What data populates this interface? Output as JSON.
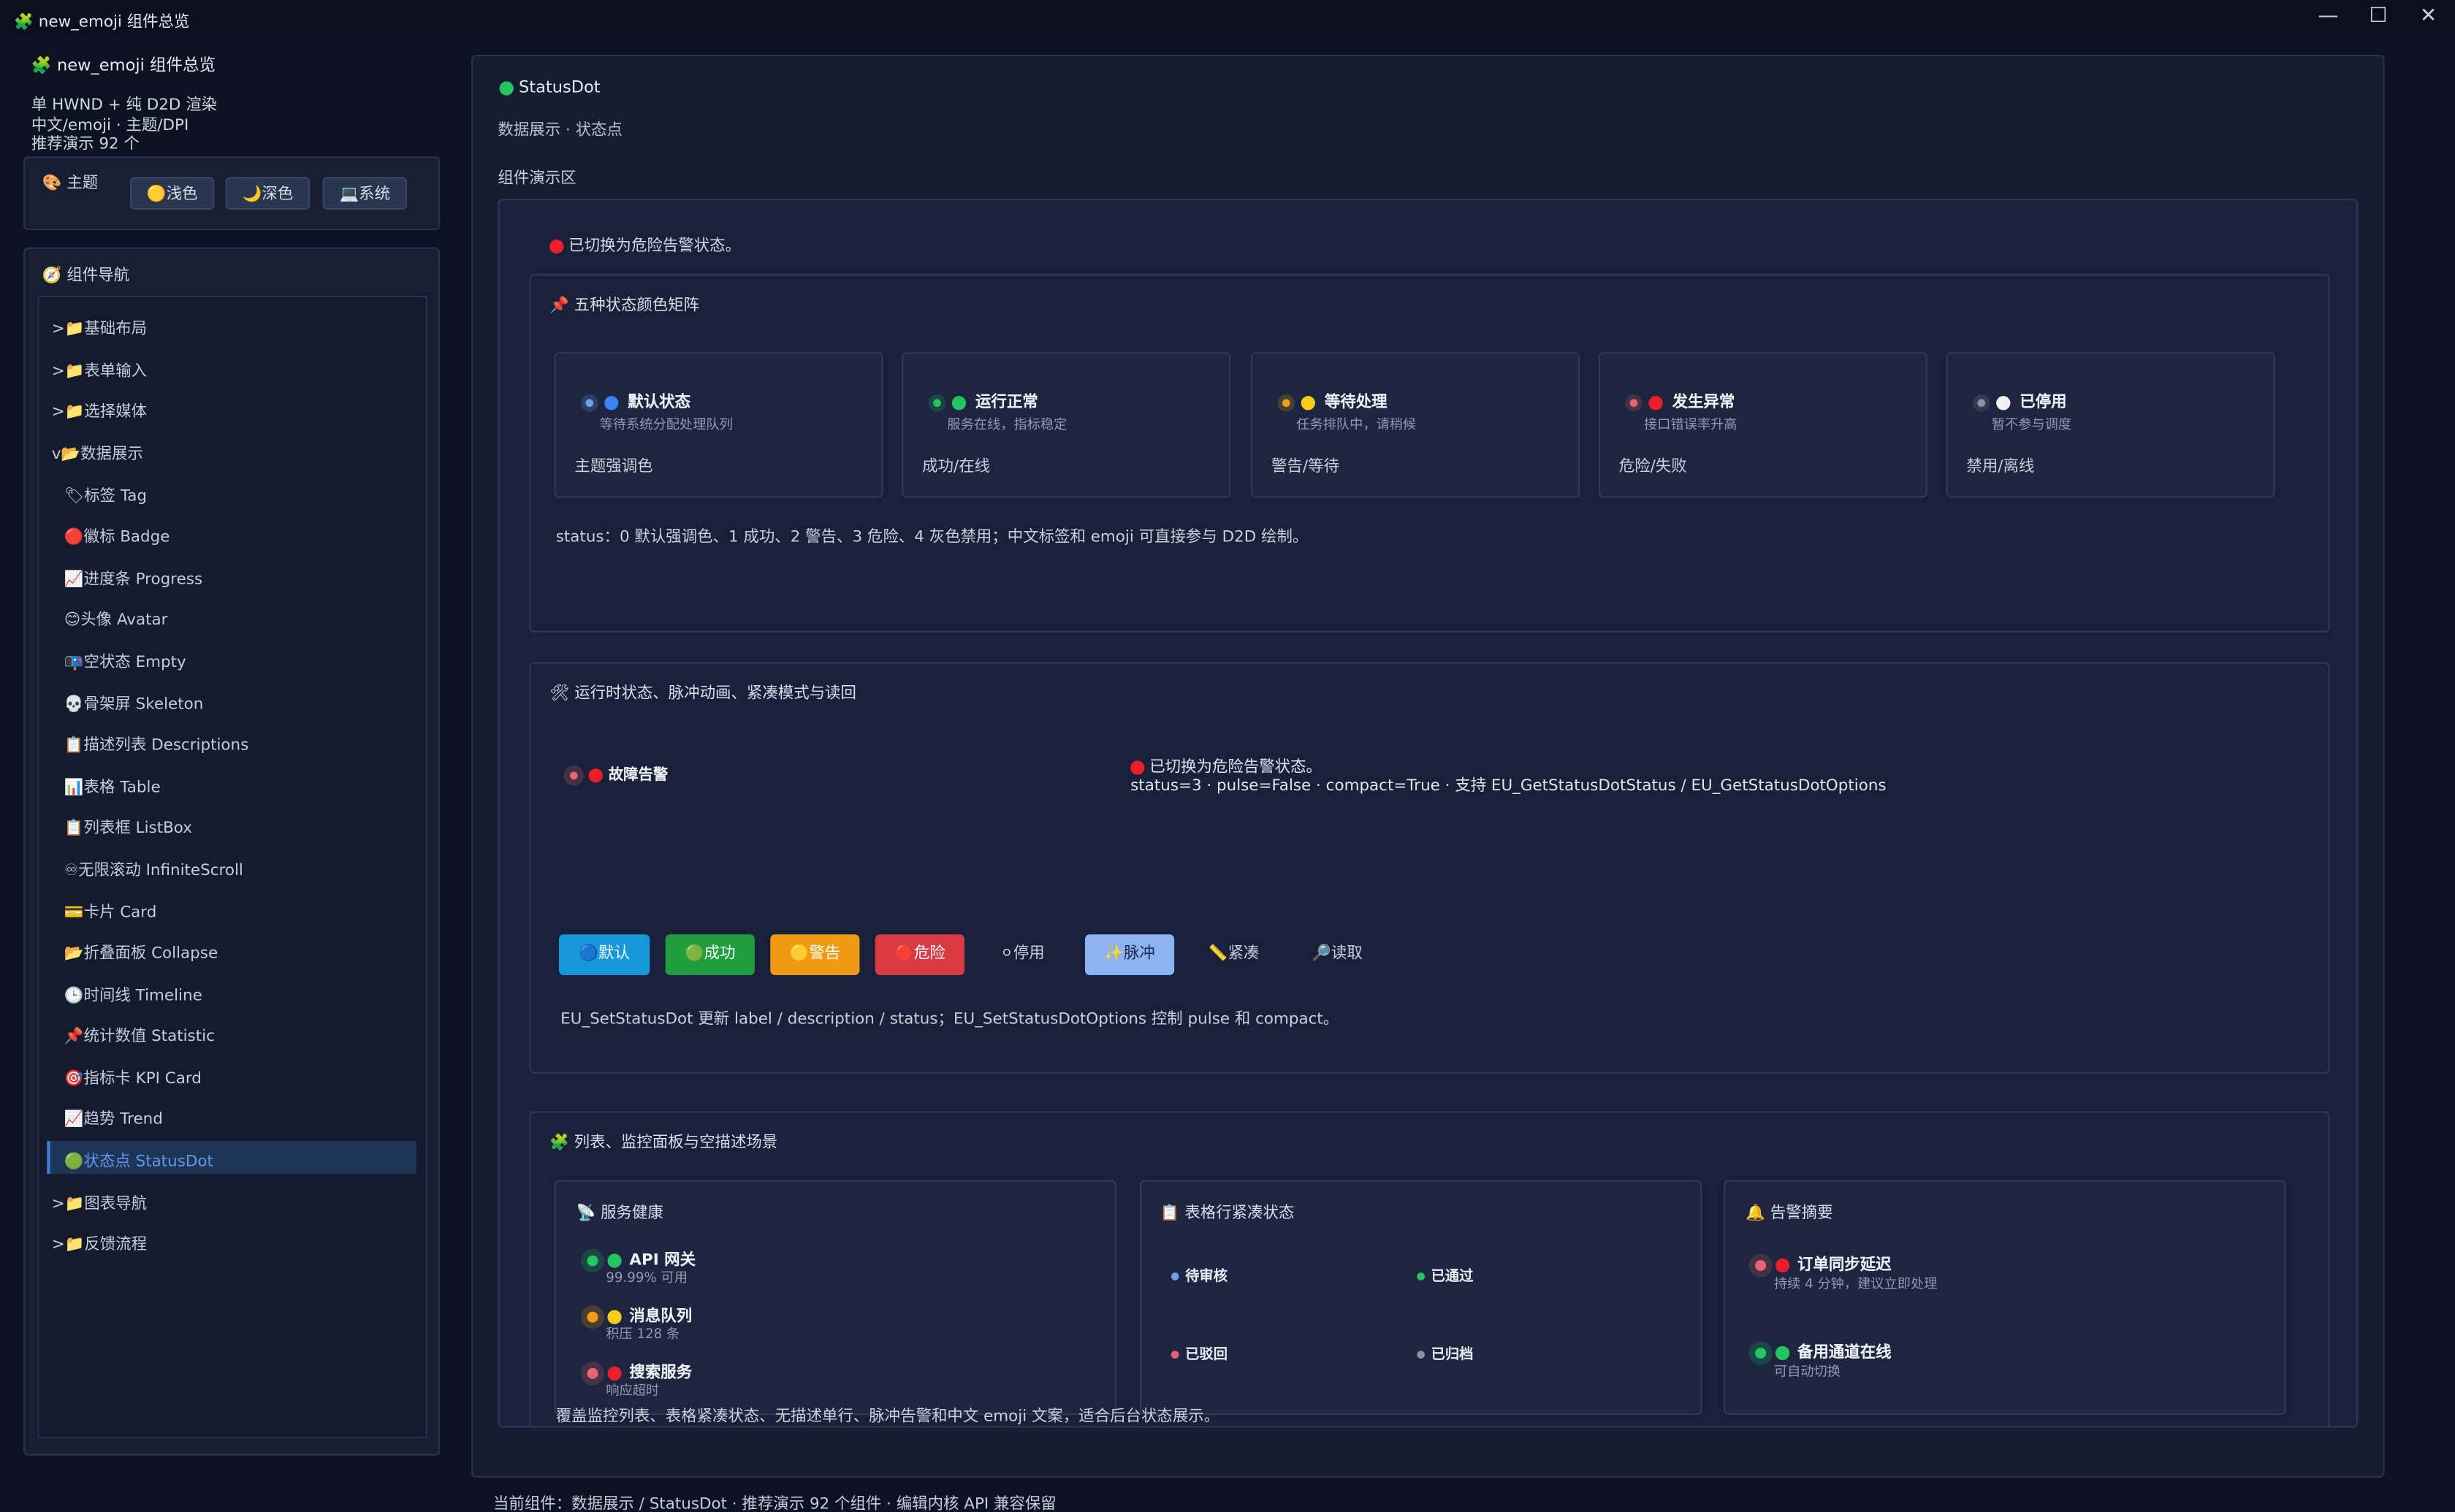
{
  "window": {
    "title": "new_emoji 组件总览",
    "controls": {
      "minimize": "—",
      "maximize": "☐",
      "close": "✕"
    }
  },
  "sidebar": {
    "app_title": "new_emoji 组件总览",
    "info_lines": [
      "单 HWND + 纯 D2D 渲染",
      "中文/emoji · 主题/DPI",
      "推荐演示 92 个"
    ],
    "theme": {
      "label": "主题",
      "buttons": [
        {
          "icon": "🟡",
          "label": "浅色"
        },
        {
          "icon": "🌙",
          "label": "深色"
        },
        {
          "icon": "💻",
          "label": "系统"
        }
      ]
    },
    "nav": {
      "label": "组件导航",
      "groups": [
        {
          "prefix": ">",
          "icon": "📁",
          "label": "基础布局"
        },
        {
          "prefix": ">",
          "icon": "📁",
          "label": "表单输入"
        },
        {
          "prefix": ">",
          "icon": "📁",
          "label": "选择媒体"
        },
        {
          "prefix": "v",
          "icon": "📂",
          "label": "数据展示"
        }
      ],
      "items": [
        {
          "icon": "🏷",
          "label": "标签 Tag"
        },
        {
          "icon": "🔴",
          "label": "徽标 Badge"
        },
        {
          "icon": "📈",
          "label": "进度条 Progress"
        },
        {
          "icon": "😊",
          "label": "头像 Avatar"
        },
        {
          "icon": "📭",
          "label": "空状态 Empty"
        },
        {
          "icon": "💀",
          "label": "骨架屏 Skeleton"
        },
        {
          "icon": "📋",
          "label": "描述列表 Descriptions"
        },
        {
          "icon": "📊",
          "label": "表格 Table"
        },
        {
          "icon": "📋",
          "label": "列表框 ListBox"
        },
        {
          "icon": "♾",
          "label": "无限滚动 InfiniteScroll"
        },
        {
          "icon": "💳",
          "label": "卡片 Card"
        },
        {
          "icon": "📂",
          "label": "折叠面板 Collapse"
        },
        {
          "icon": "🕒",
          "label": "时间线 Timeline"
        },
        {
          "icon": "📌",
          "label": "统计数值 Statistic"
        },
        {
          "icon": "🎯",
          "label": "指标卡 KPI Card"
        },
        {
          "icon": "📈",
          "label": "趋势 Trend"
        },
        {
          "icon": "🟢",
          "label": "状态点 StatusDot"
        }
      ],
      "tail_groups": [
        {
          "prefix": ">",
          "icon": "📁",
          "label": "图表导航"
        },
        {
          "prefix": ">",
          "icon": "📁",
          "label": "反馈流程"
        }
      ]
    }
  },
  "main": {
    "component_title": "StatusDot",
    "subtitle": "数据展示 · 状态点",
    "demo_area_label": "组件演示区",
    "top_status": "已切换为危险告警状态。",
    "matrix": {
      "title": "五种状态颜色矩阵",
      "cards": [
        {
          "title": "默认状态",
          "desc": "等待系统分配处理队列",
          "foot": "主题强调色",
          "color": "#3b82f6",
          "halo": "#6f9fe8"
        },
        {
          "title": "运行正常",
          "desc": "服务在线，指标稳定",
          "foot": "成功/在线",
          "color": "#22c55e",
          "halo": "#22c55e"
        },
        {
          "title": "等待处理",
          "desc": "任务排队中，请稍候",
          "foot": "警告/等待",
          "color": "#facc15",
          "halo": "#f59e0b"
        },
        {
          "title": "发生异常",
          "desc": "接口错误率升高",
          "foot": "危险/失败",
          "color": "#ef1c2a",
          "halo": "#e8646f"
        },
        {
          "title": "已停用",
          "desc": "暂不参与调度",
          "foot": "禁用/离线",
          "color": "#f2f2f2",
          "halo": "#8a93a5"
        }
      ],
      "note": "status：0 默认强调色、1 成功、2 警告、3 危险、4 灰色禁用；中文标签和 emoji 可直接参与 D2D 绘制。"
    },
    "runtime": {
      "title": "运行时状态、脉冲动画、紧凑模式与读回",
      "demo_label": "故障告警",
      "readback_line1": "已切换为危险告警状态。",
      "readback_line2": "status=3 · pulse=False · compact=True · 支持 EU_GetStatusDotStatus / EU_GetStatusDotOptions",
      "buttons": [
        {
          "icon": "🔵",
          "label": "默认",
          "bg": "#1597d9"
        },
        {
          "icon": "🟢",
          "label": "成功",
          "bg": "#1f9e3e"
        },
        {
          "icon": "🟡",
          "label": "警告",
          "bg": "#ef9a10"
        },
        {
          "icon": "🔴",
          "label": "危险",
          "bg": "#d93a43"
        },
        {
          "icon": "⚪",
          "label": "停用",
          "bg": ""
        },
        {
          "icon": "✨",
          "label": "脉冲",
          "bg": "#8cb4f2"
        },
        {
          "icon": "📏",
          "label": "紧凑",
          "bg": ""
        },
        {
          "icon": "🔎",
          "label": "读取",
          "bg": ""
        }
      ],
      "note": "EU_SetStatusDot 更新 label / description / status；EU_SetStatusDotOptions 控制 pulse 和 compact。"
    },
    "scenes": {
      "title": "列表、监控面板与空描述场景",
      "service_health": {
        "title": "服务健康",
        "items": [
          {
            "name": "API 网关",
            "desc": "99.99% 可用",
            "color": "#22c55e",
            "halo": "#22c55e"
          },
          {
            "name": "消息队列",
            "desc": "积压 128 条",
            "color": "#facc15",
            "halo": "#f59e0b"
          },
          {
            "name": "搜索服务",
            "desc": "响应超时",
            "color": "#ef1c2a",
            "halo": "#e8646f"
          }
        ]
      },
      "table_compact": {
        "title": "表格行紧凑状态",
        "items": [
          {
            "name": "待审核",
            "color": "#6f9fe8"
          },
          {
            "name": "已通过",
            "color": "#22c55e"
          },
          {
            "name": "已驳回",
            "color": "#e8646f"
          },
          {
            "name": "已归档",
            "color": "#8a93a5"
          }
        ]
      },
      "alerts": {
        "title": "告警摘要",
        "items": [
          {
            "name": "订单同步延迟",
            "desc": "持续 4 分钟，建议立即处理",
            "color": "#ef1c2a",
            "halo": "#e8646f"
          },
          {
            "name": "备用通道在线",
            "desc": "可自动切换",
            "color": "#22c55e",
            "halo": "#22c55e"
          }
        ]
      },
      "footer_note": "覆盖监控列表、表格紧凑状态、无描述单行、脉冲告警和中文 emoji 文案，适合后台状态展示。"
    }
  },
  "status_bar": "当前组件：数据展示 / StatusDot · 推荐演示 92 个组件 · 编辑内核 API 兼容保留"
}
